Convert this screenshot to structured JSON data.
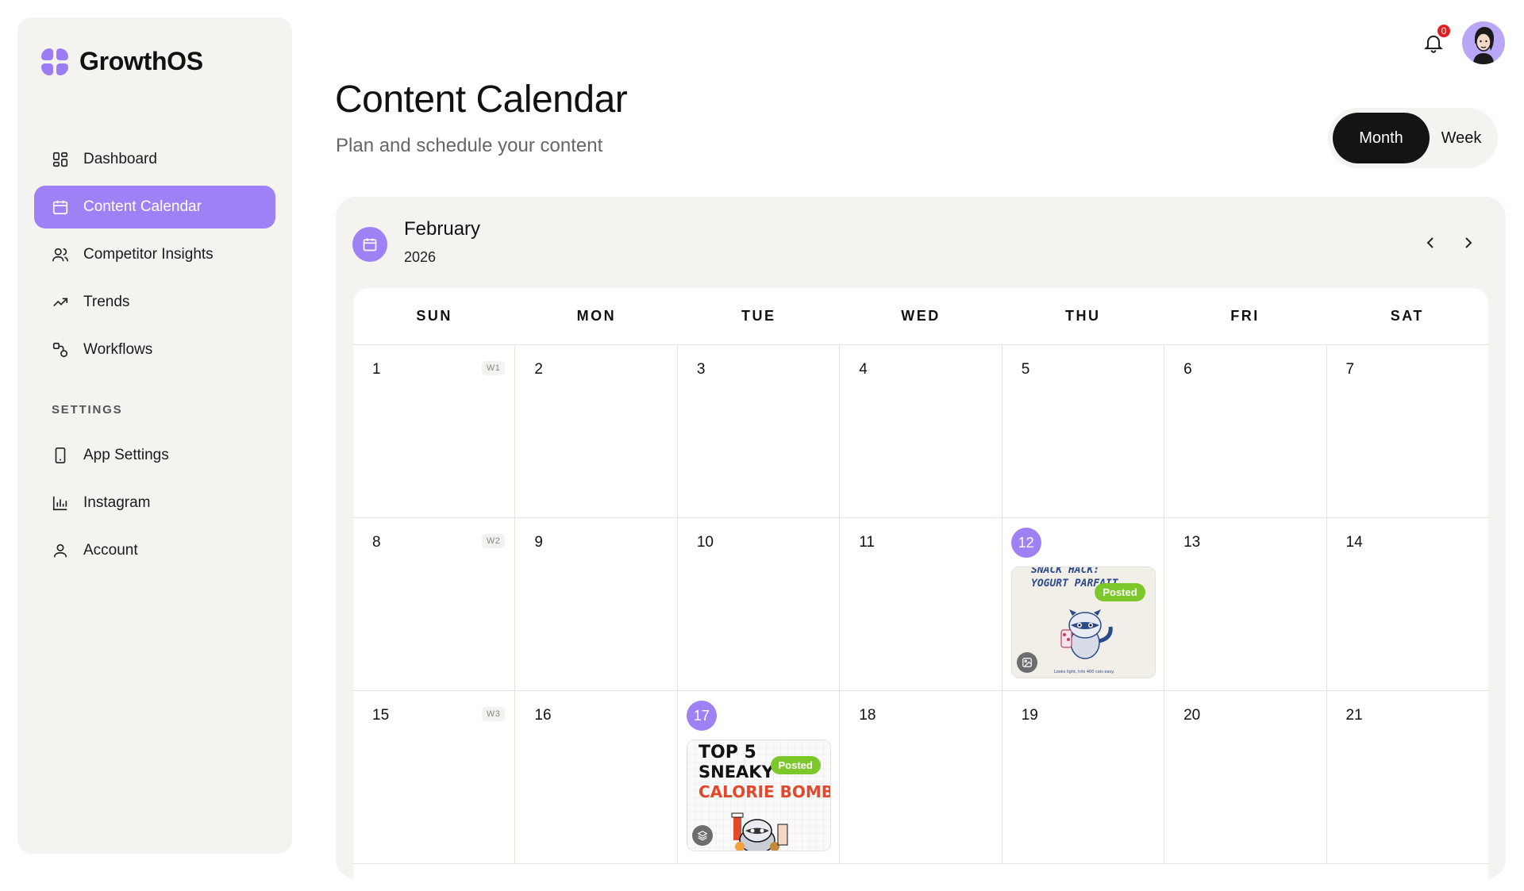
{
  "brand": {
    "name": "GrowthOS"
  },
  "sidebar": {
    "main_items": [
      {
        "label": "Dashboard",
        "icon": "dashboard-icon"
      },
      {
        "label": "Content Calendar",
        "icon": "calendar-icon",
        "active": true
      },
      {
        "label": "Competitor Insights",
        "icon": "users-icon"
      },
      {
        "label": "Trends",
        "icon": "trending-up-icon"
      },
      {
        "label": "Workflows",
        "icon": "workflow-icon"
      }
    ],
    "settings_label": "SETTINGS",
    "settings_items": [
      {
        "label": "App Settings",
        "icon": "phone-icon"
      },
      {
        "label": "Instagram",
        "icon": "bar-chart-icon"
      },
      {
        "label": "Account",
        "icon": "user-icon"
      }
    ]
  },
  "header": {
    "notification_count": "0",
    "title": "Content Calendar",
    "subtitle": "Plan and schedule your content",
    "view_toggle": {
      "month": "Month",
      "week": "Week",
      "selected": "Month"
    }
  },
  "calendar": {
    "month": "February",
    "year": "2026",
    "weekdays": [
      "SUN",
      "MON",
      "TUE",
      "WED",
      "THU",
      "FRI",
      "SAT"
    ],
    "weeks": [
      {
        "tag": "W1",
        "days": [
          "1",
          "2",
          "3",
          "4",
          "5",
          "6",
          "7"
        ]
      },
      {
        "tag": "W2",
        "days": [
          "8",
          "9",
          "10",
          "11",
          "12",
          "13",
          "14"
        ]
      },
      {
        "tag": "W3",
        "days": [
          "15",
          "16",
          "17",
          "18",
          "19",
          "20",
          "21"
        ]
      }
    ],
    "posts": [
      {
        "day": "12",
        "status": "Posted",
        "type": "image-icon",
        "headline_1": "SNACK HACK:",
        "headline_2": "YOGURT PARFAIT",
        "caption": "Looks light, hits 400 cals easy."
      },
      {
        "day": "17",
        "status": "Posted",
        "type": "carousel-icon",
        "headline_1": "TOP 5",
        "headline_2": "SNEAKY",
        "headline_3": "CALORIE BOMBS"
      }
    ],
    "colors": {
      "accent": "#9e82f5",
      "posted": "#7cc72a",
      "panel": "#f5f3f0"
    }
  }
}
